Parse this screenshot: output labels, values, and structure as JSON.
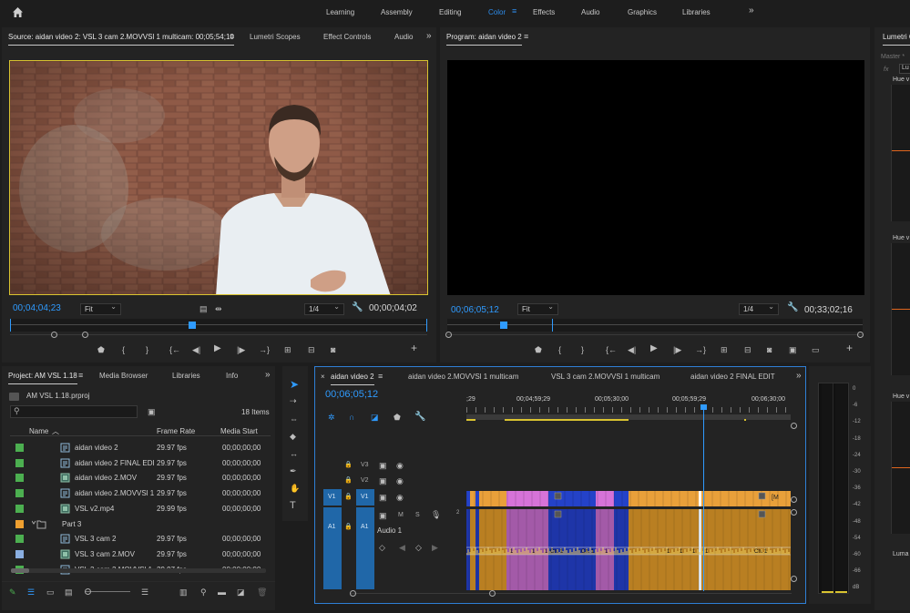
{
  "workspaces": [
    "Learning",
    "Assembly",
    "Editing",
    "Color",
    "Effects",
    "Audio",
    "Graphics",
    "Libraries"
  ],
  "workspace_active": "Color",
  "source": {
    "tab_label": "Source: aidan video 2: VSL 3 cam 2.MOVVSl 1 multicam: 00;05;54;10",
    "tabs": [
      "Lumetri Scopes",
      "Effect Controls",
      "Audio"
    ],
    "timecode": "00;04;04;23",
    "fit": "Fit",
    "res": "1/4",
    "duration": "00;00;04;02"
  },
  "program": {
    "tab_label": "Program: aidan video 2",
    "timecode": "00;06;05;12",
    "fit": "Fit",
    "res": "1/4",
    "duration": "00;33;02;16"
  },
  "lumetri": {
    "title": "Lumetri C",
    "master": "Master *",
    "fx": "fx",
    "lu": "Lu",
    "hue1": "Hue v",
    "hue2": "Hue v",
    "hue3": "Hue v",
    "luma": "Luma"
  },
  "project": {
    "tab_label": "Project: AM VSL 1.18",
    "tabs": [
      "Media Browser",
      "Libraries",
      "Info"
    ],
    "file": "AM VSL 1.18.prproj",
    "items_count": "18 Items",
    "headers": [
      "Name",
      "Frame Rate",
      "Media Start"
    ],
    "rows": [
      {
        "color": "#4caf50",
        "name": "aidan video 2",
        "rate": "29.97 fps",
        "start": "00;00;00;00",
        "icon": "sequence-icon",
        "indent": 0
      },
      {
        "color": "#4caf50",
        "name": "aidan video 2 FINAL EDI",
        "rate": "29.97 fps",
        "start": "00;00;00;00",
        "icon": "sequence-icon",
        "indent": 0
      },
      {
        "color": "#4caf50",
        "name": "aidan video 2.MOV",
        "rate": "29.97 fps",
        "start": "00;00;00;00",
        "icon": "clip-icon",
        "indent": 0
      },
      {
        "color": "#4caf50",
        "name": "aidan video 2.MOVVSl 1",
        "rate": "29.97 fps",
        "start": "00;00;00;00",
        "icon": "sequence-icon",
        "indent": 0
      },
      {
        "color": "#4caf50",
        "name": "VSL v2.mp4",
        "rate": "29.99 fps",
        "start": "00;00;00;00",
        "icon": "clip-icon",
        "indent": 0
      },
      {
        "color": "#f0a030",
        "name": "Part 3",
        "rate": "",
        "start": "",
        "icon": "folder-icon",
        "indent": -1
      },
      {
        "color": "#4caf50",
        "name": "VSL 3 cam 2",
        "rate": "29.97 fps",
        "start": "00;00;00;00",
        "icon": "sequence-icon",
        "indent": 0
      },
      {
        "color": "#8aaee0",
        "name": "VSL 3 cam 2.MOV",
        "rate": "29.97 fps",
        "start": "00;00;00;00",
        "icon": "clip-icon",
        "indent": 0
      },
      {
        "color": "#4caf50",
        "name": "VSL 3 cam 2.MOVVSl 1",
        "rate": "29.97 fps",
        "start": "00;00;00;00",
        "icon": "sequence-icon",
        "indent": 0
      }
    ]
  },
  "timeline": {
    "tabs": [
      "aidan video 2",
      "aidan video 2.MOVVSl 1 multicam",
      "VSL 3 cam 2.MOVVSl 1 multicam",
      "aidan video 2 FINAL EDIT"
    ],
    "timecode": "00;06;05;12",
    "ruler": [
      ";29",
      "00;04;59;29",
      "00;05;30;00",
      "00;05;59;29",
      "00;06;30;00"
    ],
    "tracks": [
      "V3",
      "V2",
      "V1",
      "A1"
    ],
    "audio_name": "Audio 1",
    "audio_count": "2",
    "clip_labels": [
      "1",
      "1",
      "1",
      "Ch. 1",
      "Ch. 1",
      "1",
      "1",
      "1",
      "1",
      "1",
      "Ch. 1"
    ],
    "clip_marker": "[M"
  },
  "meter": [
    "0",
    "-6",
    "-12",
    "-18",
    "-24",
    "-30",
    "-36",
    "-42",
    "-48",
    "-54",
    "-60",
    "-66",
    "dB"
  ]
}
